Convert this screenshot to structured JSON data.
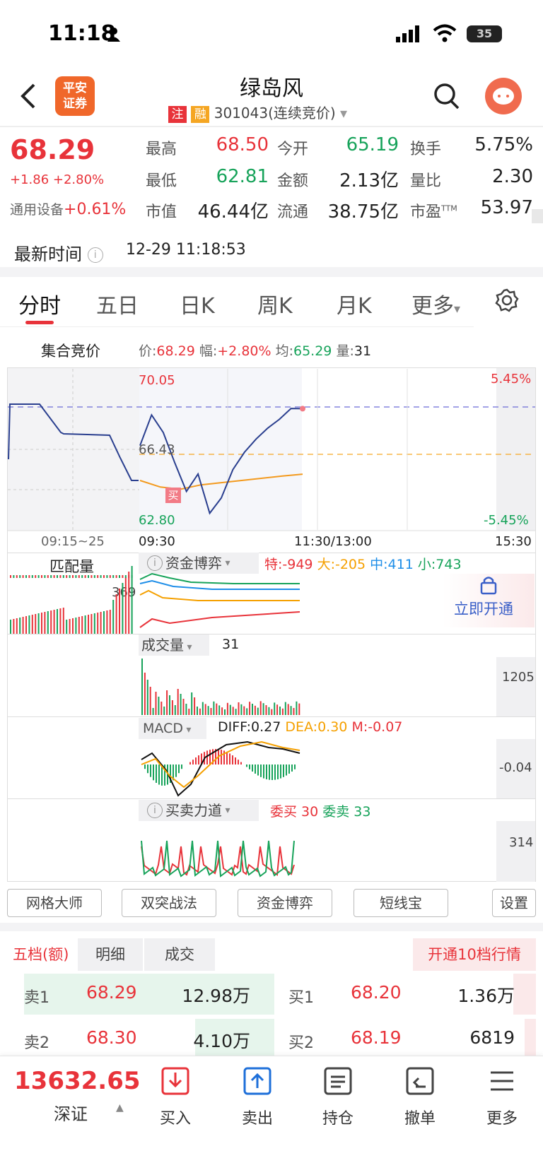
{
  "status": {
    "time": "11:18",
    "battery": "35"
  },
  "header": {
    "title": "绿岛风",
    "tag_zhu": "注",
    "tag_rong": "融",
    "code": "301043(连续竞价)",
    "logo_text": "平安证券"
  },
  "quote": {
    "price": "68.29",
    "change": "+1.86 +2.80%",
    "sector": "通用设备",
    "sector_change": "+0.61%",
    "high_label": "最高",
    "high": "68.50",
    "low_label": "最低",
    "low": "62.81",
    "mcap_label": "市值",
    "mcap": "46.44亿",
    "open_label": "今开",
    "open": "65.19",
    "amount_label": "金额",
    "amount": "2.13亿",
    "float_label": "流通",
    "float": "38.75亿",
    "turnover_label": "换手",
    "turnover": "5.75%",
    "volratio_label": "量比",
    "volratio": "2.30",
    "pe_label": "市盈",
    "pe_sup": "TTM",
    "pe": "53.97",
    "time_label": "最新时间",
    "time_value": "12-29 11:18:53"
  },
  "tabs": [
    "分时",
    "五日",
    "日K",
    "周K",
    "月K",
    "更多"
  ],
  "auction": {
    "label": "集合竞价",
    "price_label": "价:",
    "price": "68.29",
    "amp_label": "幅:",
    "amp": "+2.80%",
    "avg_label": "均:",
    "avg": "65.29",
    "vol_label": "量:",
    "vol": "31"
  },
  "chart_data": {
    "type": "line",
    "y_top": "70.05",
    "y_mid": "66.43",
    "y_bottom": "62.80",
    "pct_top": "5.45%",
    "pct_bottom": "-5.45%",
    "x_labels": [
      "09:15~25",
      "09:30",
      "11:30/13:00",
      "15:30"
    ],
    "ylim": [
      62.8,
      70.05
    ],
    "pre_close": 66.43,
    "price_series": [
      66.6,
      68.0,
      67.2,
      65.8,
      64.5,
      65.3,
      63.5,
      64.2,
      65.5,
      66.3,
      66.9,
      67.4,
      67.8,
      68.3,
      68.29
    ],
    "avg_series": [
      65.0,
      64.7,
      64.6,
      64.8,
      64.9,
      65.0,
      65.1,
      65.2,
      65.29
    ],
    "buy_mark": "买"
  },
  "indicators": {
    "match_label": "匹配量",
    "match_value": "369",
    "fund_label": "资金博弈",
    "te": "特:-949",
    "da": "大:-205",
    "zhong": "中:411",
    "xiao": "小:743",
    "unlock": "立即开通",
    "vol_label": "成交量",
    "vol_value": "31",
    "vol_axis": "1205",
    "macd_label": "MACD",
    "diff": "DIFF:0.27",
    "dea": "DEA:0.30",
    "m": "M:-0.07",
    "macd_axis": "-0.04",
    "force_label": "买卖力道",
    "wei_buy": "委买 30",
    "wei_sell": "委卖 33",
    "force_axis": "314"
  },
  "chips": [
    "网格大师",
    "双突战法",
    "资金博弈",
    "短线宝",
    "设置"
  ],
  "orderbook": {
    "tabs": [
      "五档(额)",
      "明细",
      "成交"
    ],
    "upgrade": "开通10档行情",
    "sell": [
      {
        "label": "卖1",
        "price": "68.29",
        "vol": "12.98万"
      },
      {
        "label": "卖2",
        "price": "68.30",
        "vol": "4.10万"
      }
    ],
    "buy": [
      {
        "label": "买1",
        "price": "68.20",
        "vol": "1.36万"
      },
      {
        "label": "买2",
        "price": "68.19",
        "vol": "6819"
      }
    ]
  },
  "bottom": {
    "index_value": "13632.65",
    "index_name": "深证",
    "nav": [
      "买入",
      "卖出",
      "持仓",
      "撤单",
      "更多"
    ]
  }
}
